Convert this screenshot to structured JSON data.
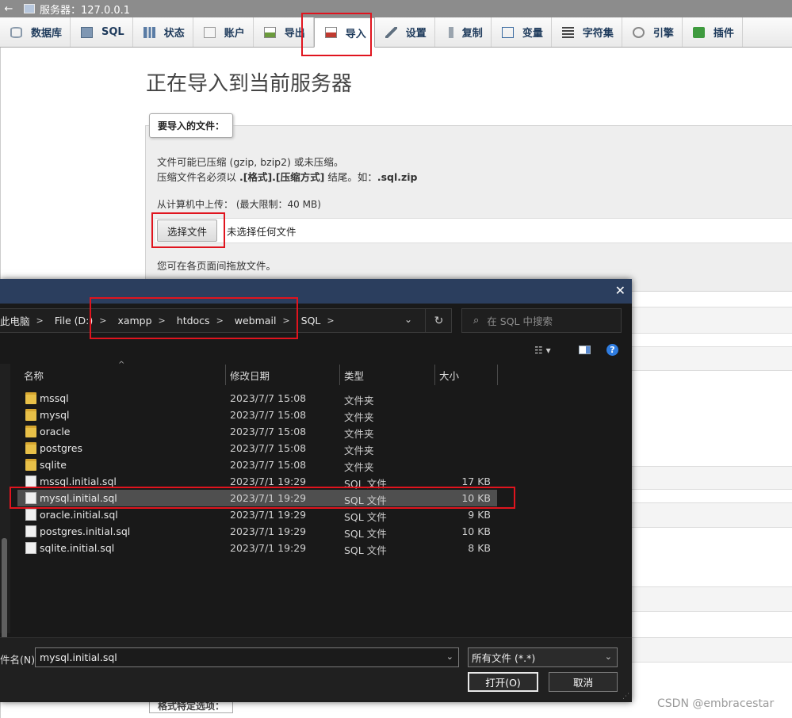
{
  "titlebar": {
    "back_glyph": "←",
    "server": "服务器：127.0.0.1"
  },
  "tabs": [
    {
      "label": "数据库",
      "icon": "database-icon"
    },
    {
      "label": "SQL",
      "icon": "sql-icon"
    },
    {
      "label": "状态",
      "icon": "status-icon"
    },
    {
      "label": "账户",
      "icon": "accounts-icon"
    },
    {
      "label": "导出",
      "icon": "export-icon"
    },
    {
      "label": "导入",
      "icon": "import-icon",
      "active": true
    },
    {
      "label": "设置",
      "icon": "settings-icon"
    },
    {
      "label": "复制",
      "icon": "replication-icon"
    },
    {
      "label": "变量",
      "icon": "variables-icon"
    },
    {
      "label": "字符集",
      "icon": "charset-icon"
    },
    {
      "label": "引擎",
      "icon": "engines-icon"
    },
    {
      "label": "插件",
      "icon": "plugins-icon"
    }
  ],
  "import_page": {
    "title": "正在导入到当前服务器",
    "legend": "要导入的文件：",
    "compress_line1": "文件可能已压缩 (gzip, bzip2) 或未压缩。",
    "compress_line2_a": "压缩文件名必须以 ",
    "compress_line2_b": ".[格式].[压缩方式]",
    "compress_line2_c": " 结尾。如：",
    "compress_line2_d": ".sql.zip",
    "upload_label": "从计算机中上传：",
    "upload_limit": "(最大限制：40 MB)",
    "choose_button": "选择文件",
    "no_file": "未选择任何文件",
    "drag_hint": "您可在各页面间拖放文件。",
    "format_legend": "格式特定选项："
  },
  "dialog": {
    "close_glyph": "✕",
    "breadcrumb": [
      "此电脑",
      "File (D:)",
      "xampp",
      "htdocs",
      "webmail",
      "SQL"
    ],
    "search_placeholder": "在 SQL 中搜索",
    "columns": {
      "name": "名称",
      "date": "修改日期",
      "type": "类型",
      "size": "大小"
    },
    "files": [
      {
        "name": "mssql",
        "date": "2023/7/7 15:08",
        "type": "文件夹",
        "size": "",
        "kind": "folder"
      },
      {
        "name": "mysql",
        "date": "2023/7/7 15:08",
        "type": "文件夹",
        "size": "",
        "kind": "folder"
      },
      {
        "name": "oracle",
        "date": "2023/7/7 15:08",
        "type": "文件夹",
        "size": "",
        "kind": "folder"
      },
      {
        "name": "postgres",
        "date": "2023/7/7 15:08",
        "type": "文件夹",
        "size": "",
        "kind": "folder"
      },
      {
        "name": "sqlite",
        "date": "2023/7/7 15:08",
        "type": "文件夹",
        "size": "",
        "kind": "folder"
      },
      {
        "name": "mssql.initial.sql",
        "date": "2023/7/1 19:29",
        "type": "SQL 文件",
        "size": "17 KB",
        "kind": "file"
      },
      {
        "name": "mysql.initial.sql",
        "date": "2023/7/1 19:29",
        "type": "SQL 文件",
        "size": "10 KB",
        "kind": "file",
        "selected": true
      },
      {
        "name": "oracle.initial.sql",
        "date": "2023/7/1 19:29",
        "type": "SQL 文件",
        "size": "9 KB",
        "kind": "file"
      },
      {
        "name": "postgres.initial.sql",
        "date": "2023/7/1 19:29",
        "type": "SQL 文件",
        "size": "10 KB",
        "kind": "file"
      },
      {
        "name": "sqlite.initial.sql",
        "date": "2023/7/1 19:29",
        "type": "SQL 文件",
        "size": "8 KB",
        "kind": "file"
      }
    ],
    "filename_label": "件名(N):",
    "filename_value": "mysql.initial.sql",
    "filetype_value": "所有文件 (*.*)",
    "open_button": "打开(O)",
    "cancel_button": "取消"
  },
  "watermark": "CSDN @embracestar",
  "colors": {
    "highlight_red": "#e0141e",
    "dialog_bg": "#191919",
    "dialog_title": "#2b3e5e"
  }
}
